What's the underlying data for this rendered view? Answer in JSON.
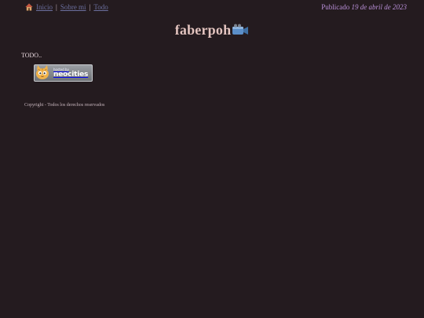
{
  "nav": {
    "home_icon": "house-icon",
    "links": [
      {
        "label": "Inicio"
      },
      {
        "label": "Sobre mi"
      },
      {
        "label": "Todo"
      }
    ],
    "link_color": "#6b6f9e"
  },
  "published": {
    "prefix": "Publicado",
    "date": "19 de abril de 2023"
  },
  "site": {
    "title": "faberpoh",
    "title_icon": "video-camera-icon"
  },
  "content": {
    "todo_text": "TODO.."
  },
  "badge": {
    "small_text": "hosted by",
    "big_text": "neocities",
    "icon": "neocities-cat-icon"
  },
  "footer": {
    "copyright": "Copyright - Todos los derechos reservados"
  },
  "colors": {
    "background": "#241b1f",
    "title": "#e3c4bf",
    "published": "#b98fd8"
  }
}
